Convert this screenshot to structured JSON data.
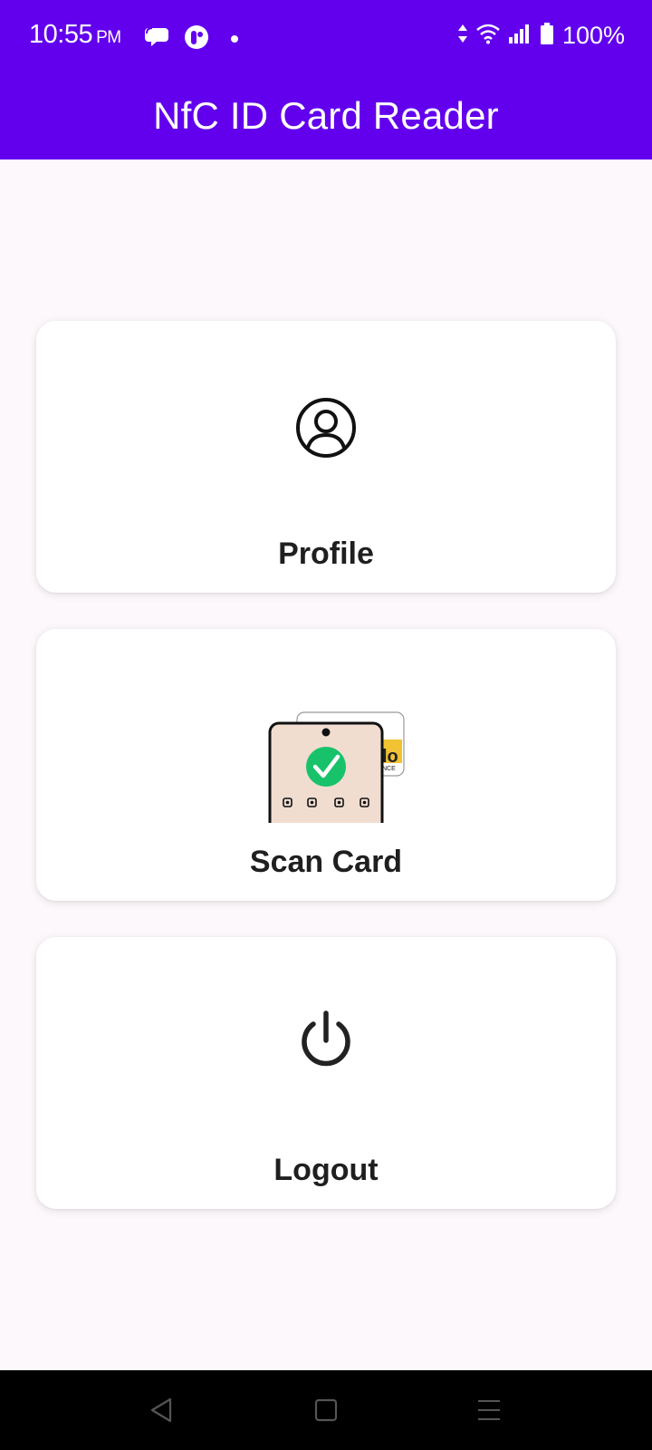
{
  "status_bar": {
    "time": "10:55",
    "ampm": "PM",
    "battery": "100%",
    "icons": [
      "chat-bubble-icon",
      "app-notification-icon",
      "dot-icon",
      "data-arrows-icon",
      "wifi-icon",
      "signal-icon",
      "battery-icon"
    ]
  },
  "app_bar": {
    "title": "NfC ID Card Reader",
    "color": "#6200ee"
  },
  "menu": {
    "profile": {
      "label": "Profile",
      "icon": "user-circle-icon"
    },
    "scan_card": {
      "label": "Scan Card",
      "icon": "phone-nfc-scan-icon"
    },
    "logout": {
      "label": "Logout",
      "icon": "power-icon"
    }
  },
  "nav_bar": {
    "buttons": [
      "back-icon",
      "home-icon",
      "menu-icon"
    ]
  }
}
